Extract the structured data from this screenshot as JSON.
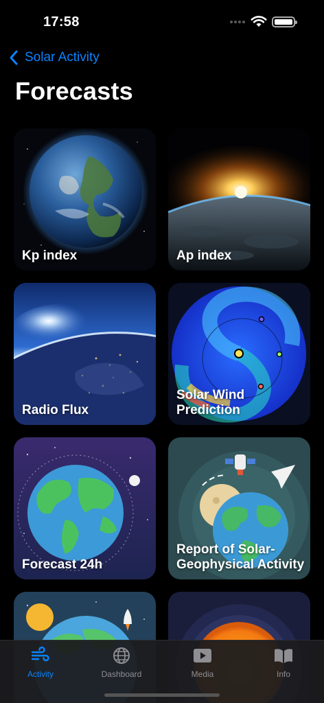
{
  "status": {
    "time": "17:58"
  },
  "nav": {
    "back_label": "Solar Activity"
  },
  "page": {
    "title": "Forecasts"
  },
  "cards": [
    {
      "label": "Kp index",
      "image": "earth-from-space"
    },
    {
      "label": "Ap index",
      "image": "sunrise-over-earth"
    },
    {
      "label": "Radio Flux",
      "image": "earth-night-lights"
    },
    {
      "label": "Solar Wind Prediction",
      "image": "solar-wind-spiral"
    },
    {
      "label": "Forecast 24h",
      "image": "earth-illustration"
    },
    {
      "label": "Report of Solar-Geophysical Activity",
      "image": "earth-satellite-illustration"
    },
    {
      "label": "",
      "image": "sun-earth-rocket-illustration"
    },
    {
      "label": "",
      "image": "sun-illustration"
    }
  ],
  "tabs": [
    {
      "label": "Activity",
      "icon": "wind-icon",
      "active": true
    },
    {
      "label": "Dashboard",
      "icon": "globe-icon",
      "active": false
    },
    {
      "label": "Media",
      "icon": "play-icon",
      "active": false
    },
    {
      "label": "Info",
      "icon": "book-icon",
      "active": false
    }
  ],
  "colors": {
    "accent": "#0a84ff",
    "background": "#000000",
    "tab_inactive": "#8e8e93"
  }
}
